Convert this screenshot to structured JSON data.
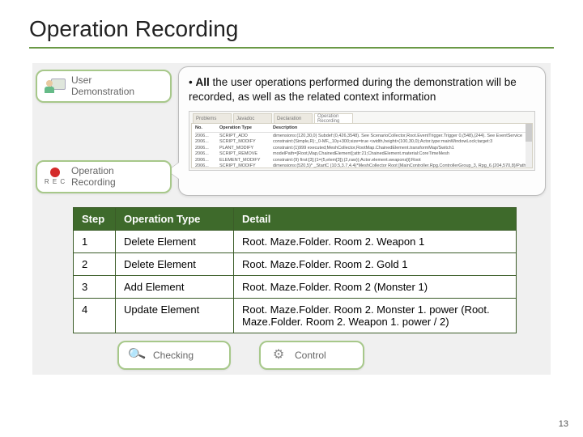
{
  "title": "Operation Recording",
  "nodes": {
    "user": "User\nDemonstration",
    "oprec": "Operation\nRecording",
    "checking": "Checking",
    "control": "Control"
  },
  "callout": {
    "lead": "All",
    "rest": " the user operations performed during the demonstration will be recorded, as well as the related context information"
  },
  "log": {
    "tabs": [
      "Problems",
      "Javadoc",
      "Declaration",
      "Operation Recording"
    ],
    "headers": [
      "No.",
      "Operation Type",
      "Description"
    ],
    "rows": [
      [
        "2006...",
        "SCRIPT_ADD",
        "dimensions:(120,30,0) Subdef:(0,426,3548). See ScenarioCollector,Root.EventTrigger.Trigger 0,(548),(244). See EventService"
      ],
      [
        "2006...",
        "SCRIPT_MODIFY",
        "constraint:(Simple,R):_0-MF,_10y+300;size=true <width,height>(100,30,0);Actor.type:mainWindowLock;target:3"
      ],
      [
        "2006...",
        "PLANT_MODIFY",
        "constraint:(1)999 executed;MeshCollector,RootMap.ChainedElement.transformMap/Switch1"
      ],
      [
        "2006...",
        "SCRIPT_REMOVE",
        "modelPath=[Root,Map,ChainedElement];attr:21;ChainedElement.material:CoreTimeMesh"
      ],
      [
        "2006...",
        "ELEMENT_MODIFY",
        "constraint:(9) first:[3];(1=(5,elem[3]);(2,raw));Actor.element.weapons[i]:Root"
      ],
      [
        "2006...",
        "SCRIPT_MODIFY",
        "dimensions:(520,5)* _StartC (10.5,3.7,4.4)*MeshCollector Root [MainController.Rpg.ControllerGroup_3, Rpg_6.(204,570,8)/Path]"
      ]
    ]
  },
  "table": {
    "headers": {
      "step": "Step",
      "type": "Operation Type",
      "detail": "Detail"
    },
    "rows": [
      {
        "step": "1",
        "type": "Delete Element",
        "detail": "Root. Maze.Folder. Room 2. Weapon 1"
      },
      {
        "step": "2",
        "type": "Delete Element",
        "detail": "Root. Maze.Folder. Room 2. Gold 1"
      },
      {
        "step": "3",
        "type": "Add Element",
        "detail": "Root. Maze.Folder. Room 2  (Monster 1)"
      },
      {
        "step": "4",
        "type": "Update Element",
        "detail": "Root. Maze.Folder. Room 2. Monster 1. power (Root. Maze.Folder. Room 2. Weapon 1. power / 2)"
      }
    ]
  },
  "page": "13"
}
